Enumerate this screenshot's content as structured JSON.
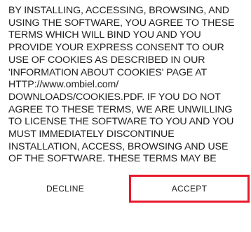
{
  "terms": {
    "lines": [
      "BY INSTALLING, ACCESSING, BROWSING, AND",
      "USING THE SOFTWARE, YOU AGREE TO THESE",
      "TERMS WHICH WILL BIND YOU AND YOU",
      "PROVIDE YOUR EXPRESS CONSENT TO OUR",
      "USE OF COOKIES AS DESCRIBED IN OUR",
      "'INFORMATION ABOUT COOKIES' PAGE AT",
      "HTTP://www.ombiel.com/",
      "DOWNLOADS/COOKIES.PDF.  IF YOU DO NOT",
      "AGREE TO THESE TERMS, WE ARE UNWILLING",
      "TO LICENSE THE SOFTWARE TO YOU AND YOU",
      "MUST IMMEDIATELY DISCONTINUE",
      "INSTALLATION, ACCESS, BROWSING AND USE",
      "OF THE SOFTWARE. THESE TERMS MAY BE"
    ]
  },
  "buttons": {
    "decline_label": "DECLINE",
    "accept_label": "ACCEPT"
  },
  "colors": {
    "accept_highlight": "#e8192c",
    "text": "#1f1f1f",
    "background": "#ffffff"
  }
}
